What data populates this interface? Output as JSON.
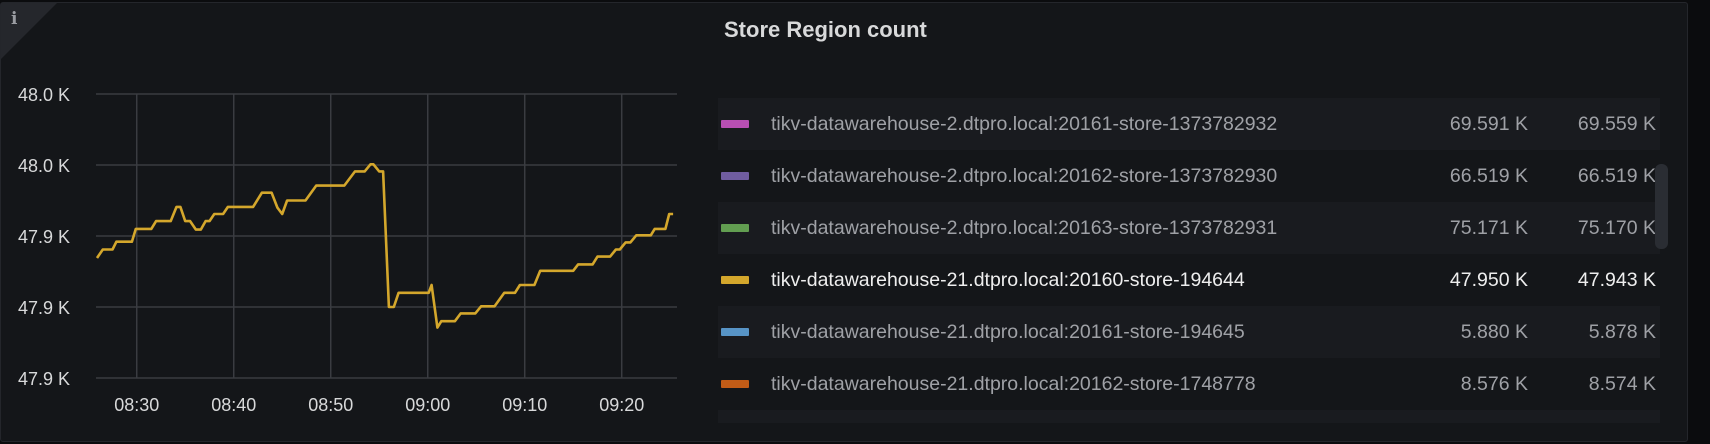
{
  "panel": {
    "title": "Store Region count",
    "info_icon": "i"
  },
  "chart_data": {
    "type": "line",
    "title": "Store Region count",
    "xlabel": "",
    "ylabel": "",
    "x_unit": "minutes since 08:30",
    "x_ticks": [
      {
        "t": 0,
        "label": "08:30"
      },
      {
        "t": 10,
        "label": "08:40"
      },
      {
        "t": 20,
        "label": "08:50"
      },
      {
        "t": 30,
        "label": "09:00"
      },
      {
        "t": 40,
        "label": "09:10"
      },
      {
        "t": 50,
        "label": "09:20"
      }
    ],
    "y_ticks": [
      {
        "v": 47.96,
        "label": "48.0 K"
      },
      {
        "v": 47.95,
        "label": "48.0 K"
      },
      {
        "v": 47.94,
        "label": "47.9 K"
      },
      {
        "v": 47.93,
        "label": "47.9 K"
      },
      {
        "v": 47.92,
        "label": "47.9 K"
      }
    ],
    "xlim": [
      -4.2,
      55.7
    ],
    "ylim": [
      47.92,
      47.96
    ],
    "grid": true,
    "series": [
      {
        "name": "tikv-datawarehouse-21.dtpro.local:20160-store-194644",
        "color": "#d4a72c",
        "x": [
          -4.1,
          -3.5,
          -2.5,
          -2.1,
          -0.5,
          -0.1,
          1.5,
          2.0,
          3.5,
          4.1,
          4.5,
          5.0,
          5.5,
          6.1,
          6.6,
          7.1,
          7.5,
          8.0,
          8.9,
          9.4,
          12.0,
          12.9,
          13.9,
          14.5,
          15.0,
          15.5,
          17.4,
          18.5,
          21.4,
          22.5,
          23.5,
          24.1,
          24.4,
          25.0,
          25.4,
          26.0,
          26.5,
          27.0,
          30.1,
          30.4,
          31.0,
          31.4,
          32.8,
          33.4,
          34.9,
          35.5,
          36.9,
          37.9,
          39.0,
          39.5,
          41.0,
          41.6,
          45.0,
          45.5,
          47.0,
          47.5,
          48.8,
          49.4,
          49.8,
          50.4,
          50.9,
          51.5,
          53.0,
          53.4,
          54.5,
          54.9,
          55.3
        ],
        "y": [
          47.9369,
          47.9381,
          47.9381,
          47.9392,
          47.9392,
          47.941,
          47.941,
          47.9421,
          47.9421,
          47.9441,
          47.9441,
          47.9421,
          47.9421,
          47.9409,
          47.9409,
          47.9421,
          47.9421,
          47.9431,
          47.9431,
          47.9441,
          47.9441,
          47.9461,
          47.9461,
          47.944,
          47.9431,
          47.945,
          47.945,
          47.9471,
          47.9471,
          47.9491,
          47.9491,
          47.9501,
          47.9501,
          47.9491,
          47.9491,
          47.93,
          47.93,
          47.932,
          47.932,
          47.9331,
          47.9271,
          47.928,
          47.928,
          47.9291,
          47.9291,
          47.9301,
          47.9301,
          47.932,
          47.932,
          47.9331,
          47.9331,
          47.9351,
          47.9351,
          47.936,
          47.936,
          47.9371,
          47.9371,
          47.9381,
          47.9381,
          47.9391,
          47.9391,
          47.9401,
          47.9401,
          47.941,
          47.941,
          47.9431,
          47.9431
        ]
      }
    ]
  },
  "legend": {
    "rows": [
      {
        "label": "tikv-datawarehouse-2.dtpro.local:20161-store-1373782932",
        "color": "#b84fb3",
        "v1": "69.591 K",
        "v2": "69.559 K"
      },
      {
        "label": "tikv-datawarehouse-2.dtpro.local:20162-store-1373782930",
        "color": "#705da0",
        "v1": "66.519 K",
        "v2": "66.519 K"
      },
      {
        "label": "tikv-datawarehouse-2.dtpro.local:20163-store-1373782931",
        "color": "#629e51",
        "v1": "75.171 K",
        "v2": "75.170 K"
      },
      {
        "label": "tikv-datawarehouse-21.dtpro.local:20160-store-194644",
        "color": "#d4a72c",
        "v1": "47.950 K",
        "v2": "47.943 K"
      },
      {
        "label": "tikv-datawarehouse-21.dtpro.local:20161-store-194645",
        "color": "#5794c6",
        "v1": "5.880 K",
        "v2": "5.878 K"
      },
      {
        "label": "tikv-datawarehouse-21.dtpro.local:20162-store-1748778",
        "color": "#c15c17",
        "v1": "8.576 K",
        "v2": "8.574 K"
      }
    ]
  }
}
